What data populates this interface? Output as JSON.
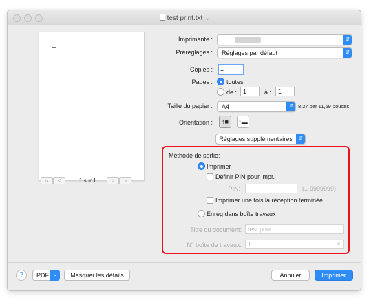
{
  "window": {
    "title": "test print.txt",
    "title_chevron": "⌄"
  },
  "preview": {
    "page_counter": "1 sur 1",
    "nav_first": "«",
    "nav_prev": "<",
    "nav_next": ">",
    "nav_last": "»"
  },
  "settings": {
    "printer_label": "Imprimante :",
    "presets_label": "Préréglages :",
    "presets_value": "Réglages par défaut",
    "copies_label": "Copies :",
    "copies_value": "1",
    "pages_label": "Pages :",
    "pages_all": "toutes",
    "pages_from": "de :",
    "pages_from_value": "1",
    "pages_to": "à :",
    "pages_to_value": "1",
    "paper_label": "Taille du papier :",
    "paper_value": "A4",
    "paper_dims": "8,27 par 11,69 pouces",
    "orientation_label": "Orientation :",
    "section_value": "Réglages supplémentaires"
  },
  "output": {
    "heading": "Méthode de sortie:",
    "print_label": "Imprimer",
    "pin_check_label": "Définir PIN pour impr.",
    "pin_label": "PIN:",
    "pin_range": "(1-9999999)",
    "print_after_label": "Imprimer une fois la réception terminée",
    "store_label": "Enreg dans boîte travaux",
    "doc_title_label": "Titre du document:",
    "doc_title_placeholder": "test print",
    "box_label": "N° boîte de travaux:",
    "box_value": "1"
  },
  "footer": {
    "help": "?",
    "pdf": "PDF",
    "hide_details": "Masquer les détails",
    "cancel": "Annuler",
    "print": "Imprimer"
  },
  "colors": {
    "accent": "#2f8cf5",
    "highlight_box": "#e8141b"
  }
}
